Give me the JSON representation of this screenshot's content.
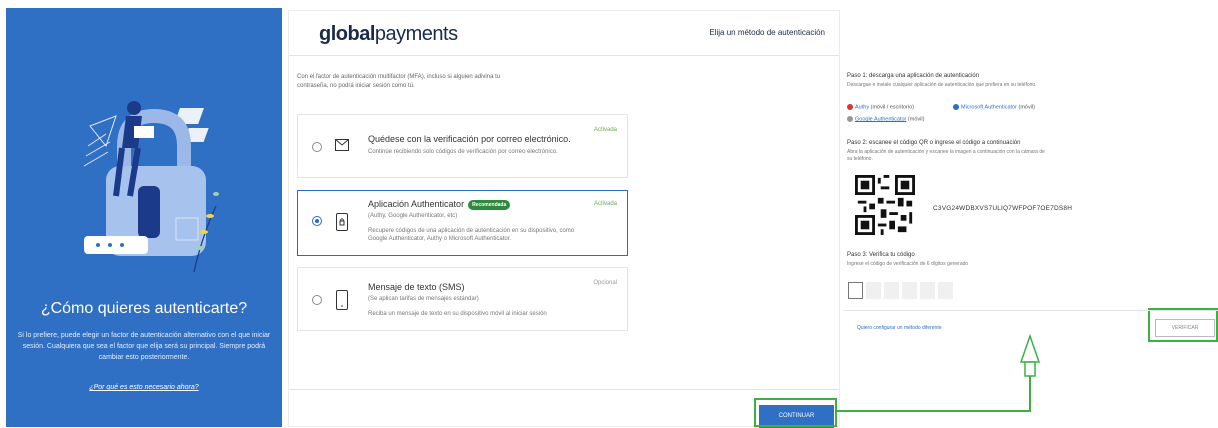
{
  "left": {
    "title": "¿Cómo quieres autenticarte?",
    "description": "Si lo prefiere, puede elegir un factor de autenticación alternativo con el que iniciar sesión. Cualquiera que sea el factor que elija será su principal. Siempre podrá cambiar esto posteriormente.",
    "link": "¿Por qué es esto necesario ahora?"
  },
  "header": {
    "logo_bold": "global",
    "logo_light": "payments",
    "right_text": "Elija un método de autenticación"
  },
  "intro": "Con el factor de autenticación multifactor (MFA), incluso si alguien adivina tu contraseña, no podrá iniciar sesión como tú.",
  "options": [
    {
      "title": "Quédese con la verificación por correo electrónico.",
      "sub": "",
      "desc": "Continúe recibiendo solo códigos de verificación por correo electrónico.",
      "status": "Activada",
      "icon": "envelope-icon"
    },
    {
      "title": "Aplicación Authenticator",
      "badge": "Recomendada",
      "sub": "(Authy, Google Authenticator, etc)",
      "desc": "Recupere códigos de una aplicación de autenticación en su dispositivo, como Google Authenticator, Authy o Microsoft Authenticator.",
      "status": "Activada",
      "icon": "phone-lock-icon"
    },
    {
      "title": "Mensaje de texto (SMS)",
      "sub": "(Se aplican tarifas de mensajes estándar)",
      "desc": "Reciba un mensaje de texto en su dispositivo móvil al iniciar sesión",
      "status": "Opcional",
      "icon": "phone-icon"
    }
  ],
  "continue_label": "CONTINUAR",
  "right": {
    "step1": "Paso 1: descarga una aplicación de autenticación",
    "step1_sub": "Descargue e instale cualquier aplicación de autenticación que prefiera en su teléfono.",
    "apps": {
      "authy": "Authy",
      "authy_suffix": "(móvil / escritorio)",
      "microsoft": "Microsoft Authenticator",
      "microsoft_suffix": "(móvil)",
      "google": "Google Authenticator",
      "google_suffix": "(móvil)"
    },
    "step2": "Paso 2: escanee el código QR o ingrese el código a continuación",
    "step2_sub": "Abra la aplicación de autenticación y escanee la imagen a continuación con la cámara de su teléfono.",
    "secret": "C3VG24WDBXVS7ULIQ7WFPOF7OE7DS8H",
    "step3": "Paso 3: Verifica tu código",
    "step3_sub": "Ingrese el código de verificación de 6 dígitos generado",
    "alt_link": "Quiero configurar un método diferente",
    "verify_label": "VERIFICAR"
  },
  "colors": {
    "brand_blue": "#2f6fc4",
    "highlight_green": "#3cb043",
    "badge_green": "#2e8b3e"
  }
}
